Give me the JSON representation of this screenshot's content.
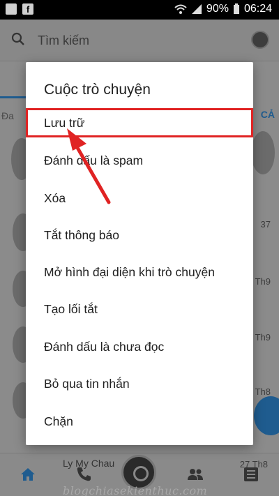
{
  "status_bar": {
    "battery": "90%",
    "time": "06:24",
    "icons": [
      "image-icon",
      "facebook-icon",
      "wifi-icon",
      "signal-icon",
      "battery-icon"
    ]
  },
  "background": {
    "search_placeholder": "Tìm kiếm",
    "left_fragment": "Đa",
    "right_fragment": "CẢ",
    "time_1": "37",
    "time_2": "Th9",
    "time_3": "Th9",
    "time_4": "Th8",
    "bottom_contact": "Ly My Chau",
    "bottom_time": "27 Th8",
    "watermark": "blogchiasekienthuc.com"
  },
  "dialog": {
    "title": "Cuộc trò chuyện",
    "items": [
      {
        "label": "Lưu trữ"
      },
      {
        "label": "Đánh dấu là spam"
      },
      {
        "label": "Xóa"
      },
      {
        "label": "Tắt thông báo"
      },
      {
        "label": "Mở hình đại diện khi trò chuyện"
      },
      {
        "label": "Tạo lối tắt"
      },
      {
        "label": "Đánh dấu là chưa đọc"
      },
      {
        "label": "Bỏ qua tin nhắn"
      },
      {
        "label": "Chặn"
      }
    ]
  },
  "annotation": {
    "highlight_color": "#e02323",
    "arrow_color": "#e02323"
  },
  "bottom_nav": {
    "icons": [
      "home-icon",
      "phone-icon",
      "camera-icon",
      "people-icon",
      "list-icon"
    ]
  }
}
